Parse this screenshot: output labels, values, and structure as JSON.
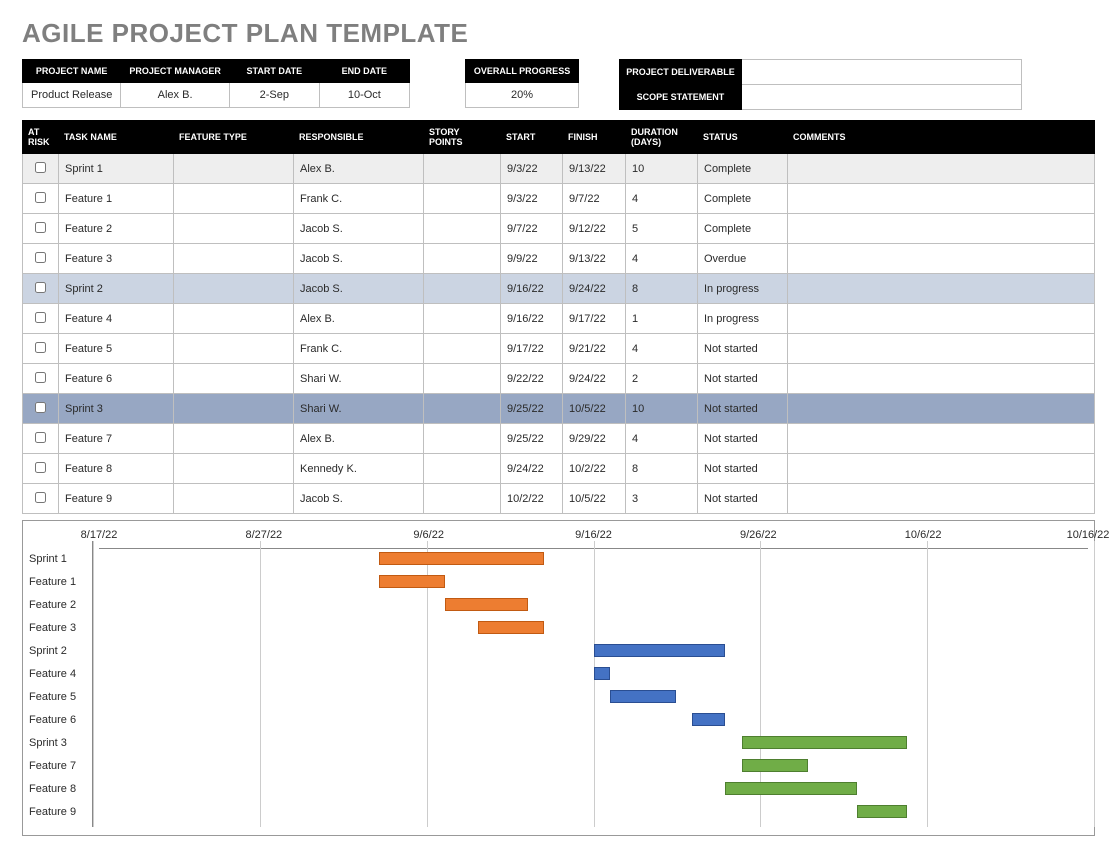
{
  "title": "AGILE PROJECT PLAN TEMPLATE",
  "info": {
    "headers": [
      "PROJECT NAME",
      "PROJECT MANAGER",
      "START DATE",
      "END DATE"
    ],
    "values": [
      "Product Release",
      "Alex B.",
      "2-Sep",
      "10-Oct"
    ],
    "progress_header": "OVERALL PROGRESS",
    "progress_value": "20%",
    "deliverable_header": "PROJECT DELIVERABLE",
    "deliverable_value": "",
    "scope_header": "SCOPE STATEMENT",
    "scope_value": ""
  },
  "tasks": {
    "headers": [
      "AT RISK",
      "TASK NAME",
      "FEATURE TYPE",
      "RESPONSIBLE",
      "STORY POINTS",
      "START",
      "FINISH",
      "DURATION (DAYS)",
      "STATUS",
      "COMMENTS"
    ],
    "rows": [
      {
        "shade": "light",
        "name": "Sprint 1",
        "feature": "",
        "resp": "Alex B.",
        "points": "",
        "start": "9/3/22",
        "finish": "9/13/22",
        "dur": "10",
        "status": "Complete",
        "comm": ""
      },
      {
        "shade": "",
        "name": "Feature 1",
        "feature": "",
        "resp": "Frank C.",
        "points": "",
        "start": "9/3/22",
        "finish": "9/7/22",
        "dur": "4",
        "status": "Complete",
        "comm": ""
      },
      {
        "shade": "",
        "name": "Feature 2",
        "feature": "",
        "resp": "Jacob S.",
        "points": "",
        "start": "9/7/22",
        "finish": "9/12/22",
        "dur": "5",
        "status": "Complete",
        "comm": ""
      },
      {
        "shade": "",
        "name": "Feature 3",
        "feature": "",
        "resp": "Jacob S.",
        "points": "",
        "start": "9/9/22",
        "finish": "9/13/22",
        "dur": "4",
        "status": "Overdue",
        "comm": ""
      },
      {
        "shade": "med",
        "name": "Sprint 2",
        "feature": "",
        "resp": "Jacob S.",
        "points": "",
        "start": "9/16/22",
        "finish": "9/24/22",
        "dur": "8",
        "status": "In progress",
        "comm": ""
      },
      {
        "shade": "",
        "name": "Feature 4",
        "feature": "",
        "resp": "Alex B.",
        "points": "",
        "start": "9/16/22",
        "finish": "9/17/22",
        "dur": "1",
        "status": "In progress",
        "comm": ""
      },
      {
        "shade": "",
        "name": "Feature 5",
        "feature": "",
        "resp": "Frank C.",
        "points": "",
        "start": "9/17/22",
        "finish": "9/21/22",
        "dur": "4",
        "status": "Not started",
        "comm": ""
      },
      {
        "shade": "",
        "name": "Feature 6",
        "feature": "",
        "resp": "Shari W.",
        "points": "",
        "start": "9/22/22",
        "finish": "9/24/22",
        "dur": "2",
        "status": "Not started",
        "comm": ""
      },
      {
        "shade": "dark",
        "name": "Sprint 3",
        "feature": "",
        "resp": "Shari W.",
        "points": "",
        "start": "9/25/22",
        "finish": "10/5/22",
        "dur": "10",
        "status": "Not started",
        "comm": ""
      },
      {
        "shade": "",
        "name": "Feature 7",
        "feature": "",
        "resp": "Alex B.",
        "points": "",
        "start": "9/25/22",
        "finish": "9/29/22",
        "dur": "4",
        "status": "Not started",
        "comm": ""
      },
      {
        "shade": "",
        "name": "Feature 8",
        "feature": "",
        "resp": "Kennedy K.",
        "points": "",
        "start": "9/24/22",
        "finish": "10/2/22",
        "dur": "8",
        "status": "Not started",
        "comm": ""
      },
      {
        "shade": "",
        "name": "Feature 9",
        "feature": "",
        "resp": "Jacob S.",
        "points": "",
        "start": "10/2/22",
        "finish": "10/5/22",
        "dur": "3",
        "status": "Not started",
        "comm": ""
      }
    ]
  },
  "chart_data": {
    "type": "gantt",
    "x_ticks": [
      "8/17/22",
      "8/27/22",
      "9/6/22",
      "9/16/22",
      "9/26/22",
      "10/6/22",
      "10/16/22"
    ],
    "x_range_days": {
      "min": "8/17/22",
      "max": "10/16/22",
      "total_days": 60
    },
    "series": [
      {
        "task": "Sprint 1",
        "start": "9/3/22",
        "end": "9/13/22",
        "color": "orange"
      },
      {
        "task": "Feature 1",
        "start": "9/3/22",
        "end": "9/7/22",
        "color": "orange"
      },
      {
        "task": "Feature 2",
        "start": "9/7/22",
        "end": "9/12/22",
        "color": "orange"
      },
      {
        "task": "Feature 3",
        "start": "9/9/22",
        "end": "9/13/22",
        "color": "orange"
      },
      {
        "task": "Sprint 2",
        "start": "9/16/22",
        "end": "9/24/22",
        "color": "blue"
      },
      {
        "task": "Feature 4",
        "start": "9/16/22",
        "end": "9/17/22",
        "color": "blue"
      },
      {
        "task": "Feature 5",
        "start": "9/17/22",
        "end": "9/21/22",
        "color": "blue"
      },
      {
        "task": "Feature 6",
        "start": "9/22/22",
        "end": "9/24/22",
        "color": "blue"
      },
      {
        "task": "Sprint 3",
        "start": "9/25/22",
        "end": "10/5/22",
        "color": "green"
      },
      {
        "task": "Feature 7",
        "start": "9/25/22",
        "end": "9/29/22",
        "color": "green"
      },
      {
        "task": "Feature 8",
        "start": "9/24/22",
        "end": "10/2/22",
        "color": "green"
      },
      {
        "task": "Feature 9",
        "start": "10/2/22",
        "end": "10/5/22",
        "color": "green"
      }
    ]
  }
}
